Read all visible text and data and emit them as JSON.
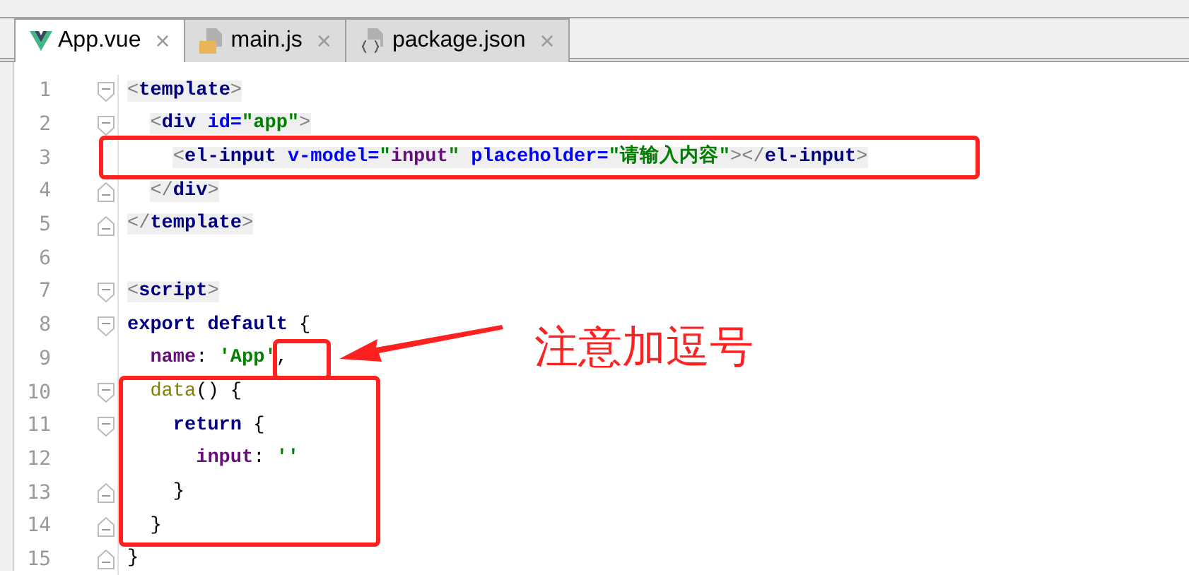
{
  "tabs": [
    {
      "label": "App.vue",
      "selected": true,
      "close": "×"
    },
    {
      "label": "main.js",
      "selected": false,
      "close": "×"
    },
    {
      "label": "package.json",
      "selected": false,
      "close": "×"
    }
  ],
  "code": [
    {
      "number": "1",
      "fold_start": true,
      "fold_end": false,
      "highlight": true,
      "tokens": [
        {
          "kind": "bracket",
          "text": "<"
        },
        {
          "kind": "tag",
          "text": "template"
        },
        {
          "kind": "bracket",
          "text": ">"
        }
      ]
    },
    {
      "number": "2",
      "fold_start": true,
      "fold_end": false,
      "highlight": true,
      "tokens": [
        {
          "kind": "bracket",
          "text": "  <"
        },
        {
          "kind": "tag",
          "text": "div "
        },
        {
          "kind": "attr",
          "text": "id="
        },
        {
          "kind": "str",
          "text": "\"app\""
        },
        {
          "kind": "bracket",
          "text": ">"
        }
      ]
    },
    {
      "number": "3",
      "fold_start": false,
      "fold_end": false,
      "highlight": true,
      "tokens": [
        {
          "kind": "bracket",
          "text": "    <"
        },
        {
          "kind": "tag",
          "text": "el-input "
        },
        {
          "kind": "attr",
          "text": "v-model="
        },
        {
          "kind": "str",
          "text": "\""
        },
        {
          "kind": "prop",
          "text": "input"
        },
        {
          "kind": "str",
          "text": "\""
        },
        {
          "kind": "attr",
          "text": " placeholder="
        },
        {
          "kind": "str",
          "text": "\"请输入内容\""
        },
        {
          "kind": "bracket",
          "text": "></"
        },
        {
          "kind": "tag",
          "text": "el-input"
        },
        {
          "kind": "bracket",
          "text": ">"
        }
      ]
    },
    {
      "number": "4",
      "fold_start": false,
      "fold_end": true,
      "highlight": true,
      "tokens": [
        {
          "kind": "bracket",
          "text": "  </"
        },
        {
          "kind": "tag",
          "text": "div"
        },
        {
          "kind": "bracket",
          "text": ">"
        }
      ]
    },
    {
      "number": "5",
      "fold_start": false,
      "fold_end": true,
      "highlight": true,
      "tokens": [
        {
          "kind": "bracket",
          "text": "</"
        },
        {
          "kind": "tag",
          "text": "template"
        },
        {
          "kind": "bracket",
          "text": ">"
        }
      ]
    },
    {
      "number": "6",
      "fold_start": false,
      "fold_end": false
    },
    {
      "number": "7",
      "fold_start": true,
      "fold_end": false,
      "highlight": true,
      "tokens": [
        {
          "kind": "bracket",
          "text": "<"
        },
        {
          "kind": "tag",
          "text": "script"
        },
        {
          "kind": "bracket",
          "text": ">"
        }
      ]
    },
    {
      "number": "8",
      "fold_start": true,
      "fold_end": false,
      "highlight": false,
      "tokens": [
        {
          "kind": "kw",
          "text": "export default "
        },
        {
          "kind": "plain",
          "text": "{"
        }
      ]
    },
    {
      "number": "9",
      "fold_start": false,
      "fold_end": false,
      "highlight": false,
      "tokens": [
        {
          "kind": "prop",
          "text": "  name"
        },
        {
          "kind": "plain",
          "text": ": "
        },
        {
          "kind": "str",
          "text": "'App'"
        },
        {
          "kind": "plain",
          "text": ","
        }
      ]
    },
    {
      "number": "10",
      "fold_start": true,
      "fold_end": false,
      "highlight": false,
      "tokens": [
        {
          "kind": "fn",
          "text": "  data"
        },
        {
          "kind": "plain",
          "text": "() {"
        }
      ]
    },
    {
      "number": "11",
      "fold_start": true,
      "fold_end": false,
      "highlight": false,
      "tokens": [
        {
          "kind": "kw",
          "text": "    return "
        },
        {
          "kind": "plain",
          "text": "{"
        }
      ]
    },
    {
      "number": "12",
      "fold_start": false,
      "fold_end": false,
      "highlight": false,
      "tokens": [
        {
          "kind": "prop",
          "text": "      input"
        },
        {
          "kind": "plain",
          "text": ": "
        },
        {
          "kind": "str",
          "text": "''"
        }
      ]
    },
    {
      "number": "13",
      "fold_start": false,
      "fold_end": true,
      "highlight": false,
      "tokens": [
        {
          "kind": "plain",
          "text": "    }"
        }
      ]
    },
    {
      "number": "14",
      "fold_start": false,
      "fold_end": true,
      "highlight": false,
      "tokens": [
        {
          "kind": "plain",
          "text": "  }"
        }
      ]
    },
    {
      "number": "15",
      "fold_start": false,
      "fold_end": true,
      "highlight": false,
      "tokens": [
        {
          "kind": "plain",
          "text": "}"
        }
      ]
    }
  ],
  "annotation": {
    "text": "注意加逗号"
  }
}
